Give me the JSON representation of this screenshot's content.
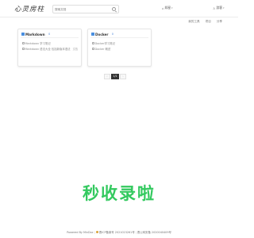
{
  "header": {
    "logo": "心灵房柱",
    "search_placeholder": "搜索文档",
    "site_menu": "邦屋",
    "user_menu": "游客"
  },
  "toolbar": {
    "items": [
      "我的工具",
      "项目",
      "分享"
    ]
  },
  "cards": [
    {
      "title": "Markdown",
      "badge": "0",
      "docs": [
        {
          "name": "Markdown 学习笔记",
          "tag": ""
        },
        {
          "name": "Markdown 语法大全 包括新版本语法",
          "tag": "文档"
        }
      ]
    },
    {
      "title": "Docker",
      "badge": "0",
      "docs": [
        {
          "name": "Docker学习笔记",
          "tag": ""
        },
        {
          "name": "Docker 概述",
          "tag": ""
        }
      ]
    }
  ],
  "pagination": {
    "prev": "‹",
    "current": "1/1",
    "next": "›"
  },
  "watermark": "秒收录啦",
  "footer": {
    "powered": "Powered By MinDoc",
    "icp": "晋ICP备案号 2021023261号",
    "police": "晋公网安备 2020040409号"
  },
  "colors": {
    "accent": "#3a7bd5",
    "watermark": "#33c95f",
    "active_page": "#333333"
  }
}
